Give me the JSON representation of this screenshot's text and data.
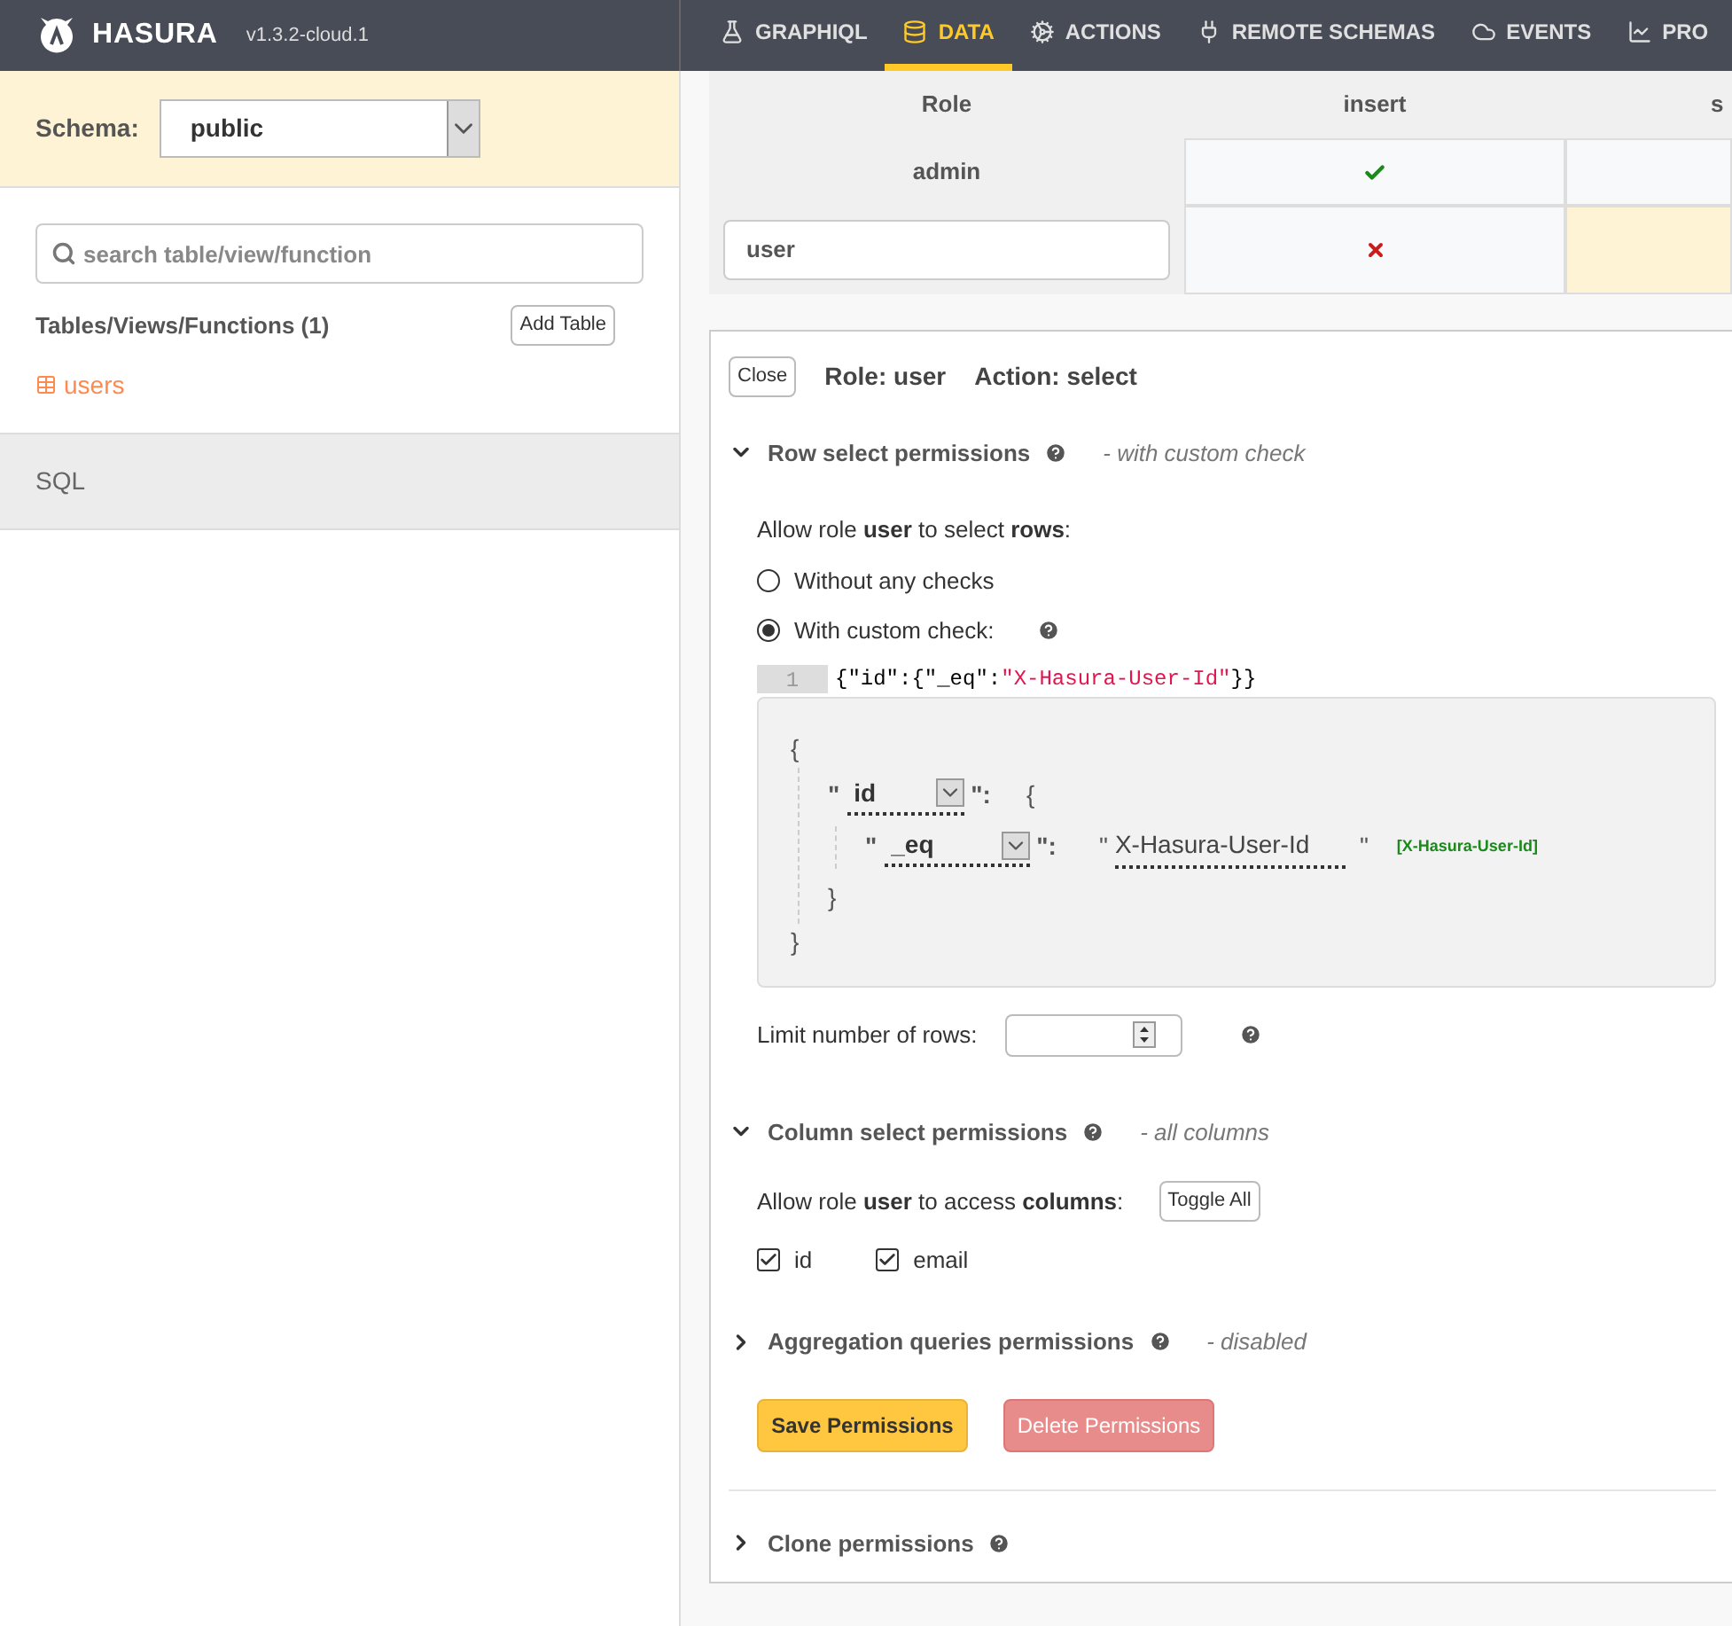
{
  "header": {
    "brand": "HASURA",
    "version": "v1.3.2-cloud.1",
    "nav": [
      {
        "label": "GRAPHIQL",
        "kind": "flask",
        "selected": false
      },
      {
        "label": "DATA",
        "kind": "database",
        "selected": true
      },
      {
        "label": "ACTIONS",
        "kind": "cogs",
        "selected": false
      },
      {
        "label": "REMOTE SCHEMAS",
        "kind": "plug",
        "selected": false
      },
      {
        "label": "EVENTS",
        "kind": "cloud",
        "selected": false
      },
      {
        "label": "PRO",
        "kind": "chart",
        "selected": false
      }
    ]
  },
  "sidebar": {
    "schema_label": "Schema:",
    "schema_value": "public",
    "search": {
      "placeholder": "search table/view/function"
    },
    "list_title": "Tables/Views/Functions (1)",
    "add_button": "Add Table",
    "tables": [
      {
        "name": "users"
      }
    ],
    "sql": "SQL"
  },
  "permissions_table": {
    "columns": [
      "Role",
      "insert",
      "s"
    ],
    "rows": [
      {
        "role": "admin",
        "kind": "text",
        "cells": [
          {
            "kind": "check",
            "selected": false
          },
          {
            "kind": "empty",
            "selected": false
          }
        ]
      },
      {
        "role": "user",
        "kind": "input",
        "cells": [
          {
            "kind": "cross",
            "selected": false
          },
          {
            "kind": "empty",
            "selected": true
          }
        ]
      }
    ]
  },
  "editor": {
    "close_button": "Close",
    "role_title": "Role: user",
    "action_title": "Action: select",
    "row_section": {
      "title": "Row select permissions",
      "note": "- with custom check",
      "expanded": true,
      "prompt": "Allow role **user** to select **rows**:",
      "options": [
        {
          "label": "Without any checks",
          "selected": false
        },
        {
          "label": "With custom check:",
          "selected": true
        }
      ],
      "code": {
        "line_number": "1",
        "tokens": [
          {
            "kind": "punct",
            "text": "{\"id\":{\"_eq\":"
          },
          {
            "kind": "string",
            "text": "\"X-Hasura-User-Id\""
          },
          {
            "kind": "punct",
            "text": "}}"
          }
        ]
      },
      "builder": {
        "open": "{",
        "key_open": "\"",
        "column": "id",
        "key_close": "\":",
        "close": "}",
        "inner": {
          "open": "{",
          "key_open": "\"",
          "operator": "_eq",
          "key_close": "\":",
          "value_open": "\"",
          "value": "X-Hasura-User-Id",
          "value_close": "\"",
          "hint": "[X-Hasura-User-Id]",
          "close": "}"
        }
      },
      "limit_label": "Limit number of rows:"
    },
    "column_section": {
      "title": "Column select permissions",
      "note": "- all columns",
      "expanded": true,
      "prompt": "Allow role **user** to access **columns**:",
      "toggle_button": "Toggle All",
      "columns": [
        {
          "name": "id",
          "checked": true
        },
        {
          "name": "email",
          "checked": true
        }
      ]
    },
    "aggregation_section": {
      "title": "Aggregation queries permissions",
      "note": "- disabled",
      "expanded": false
    },
    "save_button": "Save Permissions",
    "delete_button": "Delete Permissions",
    "clone_section": {
      "title": "Clone permissions",
      "expanded": false
    }
  }
}
